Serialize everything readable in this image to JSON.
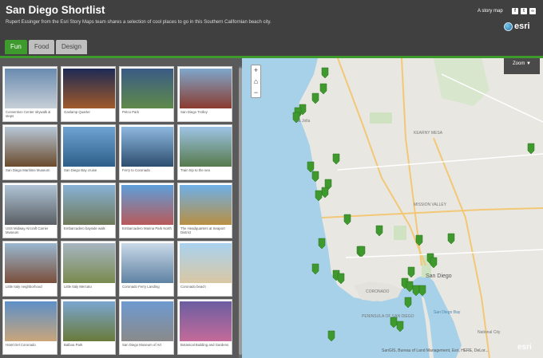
{
  "header": {
    "title": "San Diego Shortlist",
    "subtitle": "Rupert Essinger from the Esri Story Maps team shares a selection of cool places to go in this Southern Californian beach city.",
    "story_map_label": "A story map",
    "social": [
      "f",
      "t",
      "link"
    ],
    "logo_text": "esri"
  },
  "tabs": [
    {
      "label": "Fun",
      "active": true
    },
    {
      "label": "Food",
      "active": false
    },
    {
      "label": "Design",
      "active": false
    }
  ],
  "gallery": {
    "items": [
      "Convention Center skywalk & steps",
      "Gaslamp Quarter",
      "Petco Park",
      "San Diego Trolley",
      "San Diego Maritime Museum",
      "San Diego Bay cruise",
      "Ferry to Coronado",
      "Train trip to the sea",
      "USS Midway Aircraft Carrier Museum",
      "Embarcadero bayside walk",
      "Embarcadero Marina Park North",
      "The Headquarters at Seaport District",
      "Little Italy neighborhood",
      "Little Italy Mercato",
      "Coronado Ferry Landing",
      "Coronado beach",
      "Hotel Del Coronado",
      "Balboa Park",
      "San Diego Museum of Art",
      "Botanical Building and Gardens"
    ]
  },
  "map": {
    "zoom_in": "+",
    "home": "⌂",
    "zoom_out": "−",
    "zoom_menu": "Zoom ▼",
    "attribution": "SanGIS, Bureau of Land Management, Esri, HERE, DeLor...",
    "watermark": "esri",
    "labels": [
      "La Jolla",
      "KEARNY MESA",
      "MISSION VALLEY",
      "San Diego",
      "CORONADO",
      "PENINSULA OF SAN DIEGO",
      "San Diego Bay",
      "National City"
    ]
  },
  "colors": {
    "header_bg": "#404040",
    "accent": "#3f9a2e",
    "marker": "#3f9a2e",
    "ocean": "#a6d1e8"
  }
}
